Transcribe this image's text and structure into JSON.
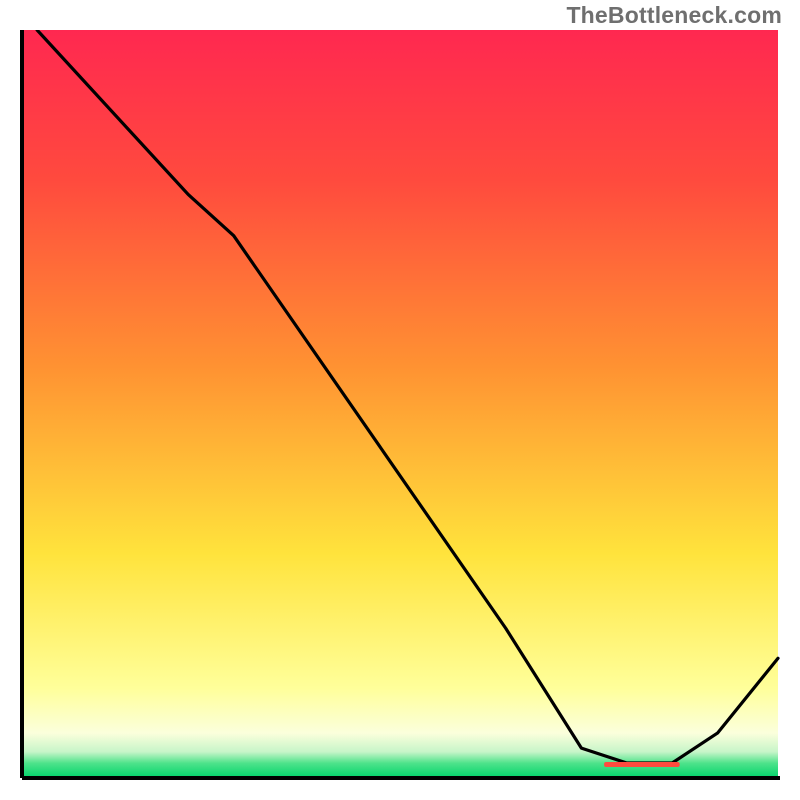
{
  "watermark": "TheBottleneck.com",
  "chart_data": {
    "type": "line",
    "title": "",
    "xlabel": "",
    "ylabel": "",
    "xlim": [
      0,
      100
    ],
    "ylim": [
      0,
      100
    ],
    "legend": null,
    "note": "Axes are unlabeled; values are normalized 0..100. Curve estimated from pixel positions. Lower in plot = larger y-value (plot has low values at bottom).",
    "axis_origin": "bottom-left",
    "background_gradient_stops": [
      {
        "pos": 0.0,
        "color": "#00d46a"
      },
      {
        "pos": 0.02,
        "color": "#4fe38b"
      },
      {
        "pos": 0.035,
        "color": "#c7f5c9"
      },
      {
        "pos": 0.06,
        "color": "#fbffdc"
      },
      {
        "pos": 0.12,
        "color": "#ffff9a"
      },
      {
        "pos": 0.3,
        "color": "#ffe33c"
      },
      {
        "pos": 0.55,
        "color": "#ff9232"
      },
      {
        "pos": 0.8,
        "color": "#ff4a3e"
      },
      {
        "pos": 1.0,
        "color": "#ff2850"
      }
    ],
    "series": [
      {
        "name": "curve",
        "color": "#000000",
        "points": [
          {
            "x": 2.0,
            "y": 100.0
          },
          {
            "x": 22.0,
            "y": 78.0
          },
          {
            "x": 28.0,
            "y": 72.5
          },
          {
            "x": 64.0,
            "y": 20.0
          },
          {
            "x": 74.0,
            "y": 4.0
          },
          {
            "x": 80.0,
            "y": 2.0
          },
          {
            "x": 86.0,
            "y": 2.0
          },
          {
            "x": 92.0,
            "y": 6.0
          },
          {
            "x": 100.0,
            "y": 16.0
          }
        ]
      }
    ],
    "marker": {
      "name": "min-band",
      "color": "#ff4a3e",
      "x_start": 77.0,
      "x_end": 87.0,
      "y": 1.8,
      "thickness_px": 5
    }
  }
}
